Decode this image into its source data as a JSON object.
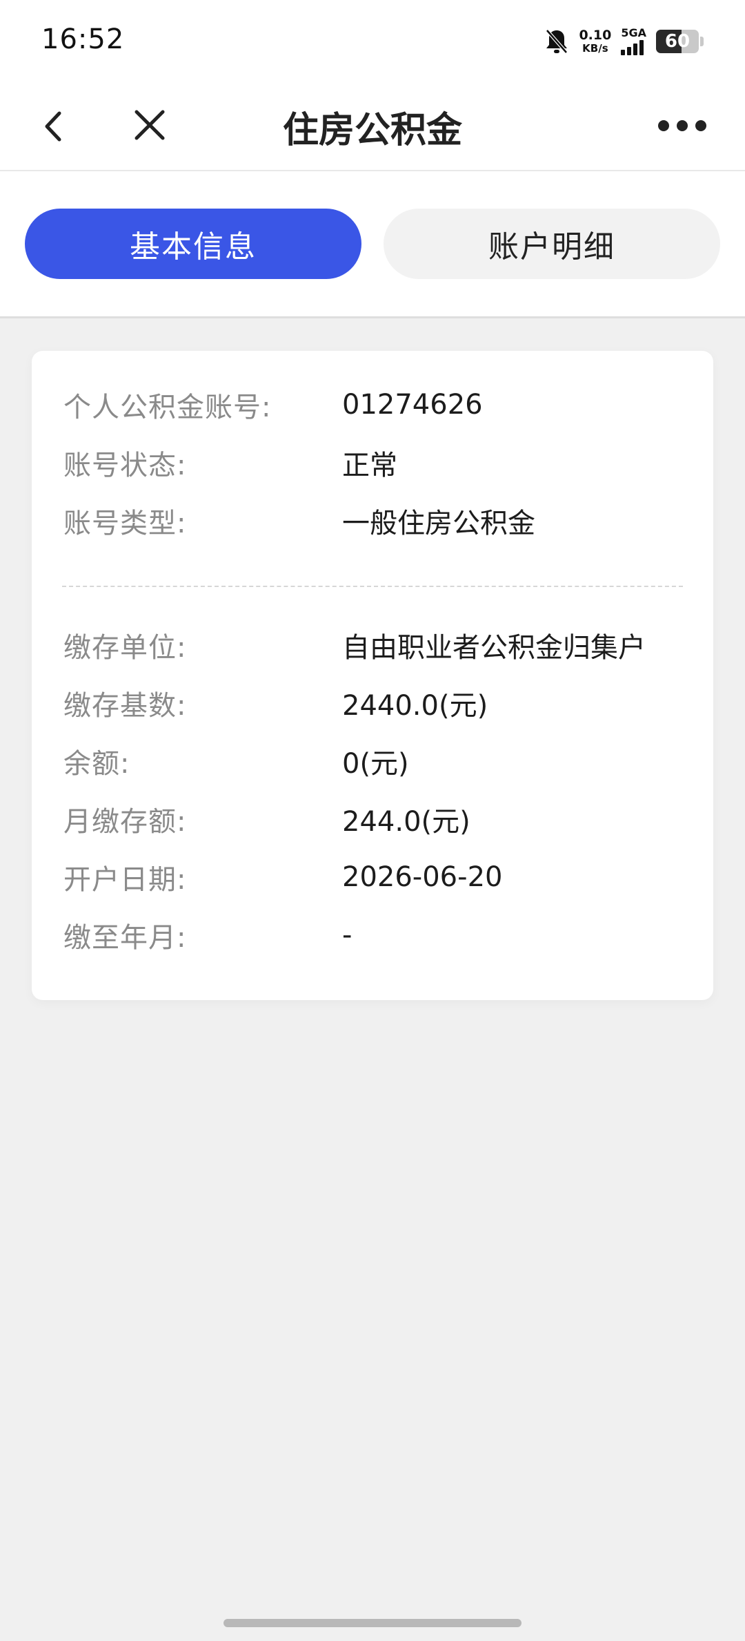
{
  "status_bar": {
    "time": "16:52",
    "net_speed_value": "0.10",
    "net_speed_unit": "KB/s",
    "network": "5GA",
    "battery": "60"
  },
  "nav": {
    "title": "住房公积金",
    "back_icon": "chevron-left-icon",
    "close_icon": "close-icon",
    "more_icon": "more-dots-icon"
  },
  "tabs": [
    {
      "label": "基本信息",
      "active": true
    },
    {
      "label": "账户明细",
      "active": false
    }
  ],
  "account": {
    "rows_top": [
      {
        "label": "个人公积金账号:",
        "value": "01274626"
      },
      {
        "label": "账号状态:",
        "value": "正常"
      },
      {
        "label": "账号类型:",
        "value": "一般住房公积金"
      }
    ],
    "rows_bottom": [
      {
        "label": "缴存单位:",
        "value": "自由职业者公积金归集户"
      },
      {
        "label": "缴存基数:",
        "value": "2440.0(元)"
      },
      {
        "label": "余额:",
        "value": "0(元)"
      },
      {
        "label": "月缴存额:",
        "value": "244.0(元)"
      },
      {
        "label": "开户日期:",
        "value": "2026-06-20"
      },
      {
        "label": "缴至年月:",
        "value": "-"
      }
    ]
  },
  "colors": {
    "accent": "#3a56e6",
    "background": "#f0f0f0",
    "label": "#8a8a8a"
  }
}
